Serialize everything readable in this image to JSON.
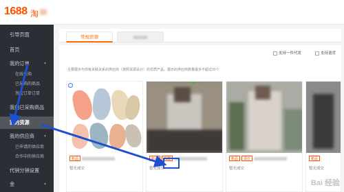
{
  "header": {
    "logo": "1688",
    "logo_suffix": "淘"
  },
  "sidebar": {
    "items": [
      {
        "label": "引导页面",
        "level": 1
      },
      {
        "label": "首页",
        "level": 1
      },
      {
        "label": "我的订单",
        "level": 1,
        "expandable": true
      },
      {
        "label": "在线采购",
        "level": 2
      },
      {
        "label": "已采购的商品",
        "level": 2
      },
      {
        "label": "淘宝订单订单",
        "level": 2
      },
      {
        "label": "我的已采购商品",
        "level": 1
      },
      {
        "label": "我的货源",
        "level": 1,
        "active": true
      },
      {
        "label": "我的供应商",
        "level": 1,
        "expandable": true
      },
      {
        "label": "已申请的供应商",
        "level": 2
      },
      {
        "label": "合作中的供应商",
        "level": 2
      },
      {
        "label": "代销分销设置",
        "level": 1
      },
      {
        "label": "金",
        "level": 1,
        "expandable": true
      }
    ]
  },
  "main": {
    "tabs": [
      {
        "label": "常规货源",
        "active": true
      },
      {
        "label": ""
      }
    ],
    "filters": [
      {
        "label": "支持一件代发"
      },
      {
        "label": "支持退货"
      }
    ],
    "notice": "主要展示与你有关联关系的供应商（按照货源设计）的优质产品，展示的供应商数量最多不超过20个",
    "cards": [
      {
        "tags": [
          "新品"
        ],
        "status": "暂无成交"
      },
      {
        "tags": [
          "新品",
          "代发"
        ],
        "status": "暂无成交"
      },
      {
        "tags": [
          "新品",
          "源价"
        ],
        "status": "暂无成交"
      },
      {
        "tags": [
          "新品"
        ],
        "status": "暂无成交"
      }
    ]
  },
  "watermark": "Bai 经验",
  "colors": {
    "brand": "#ff5000",
    "sidebar_bg": "#2b2e34",
    "highlight": "#1f4fd1"
  }
}
